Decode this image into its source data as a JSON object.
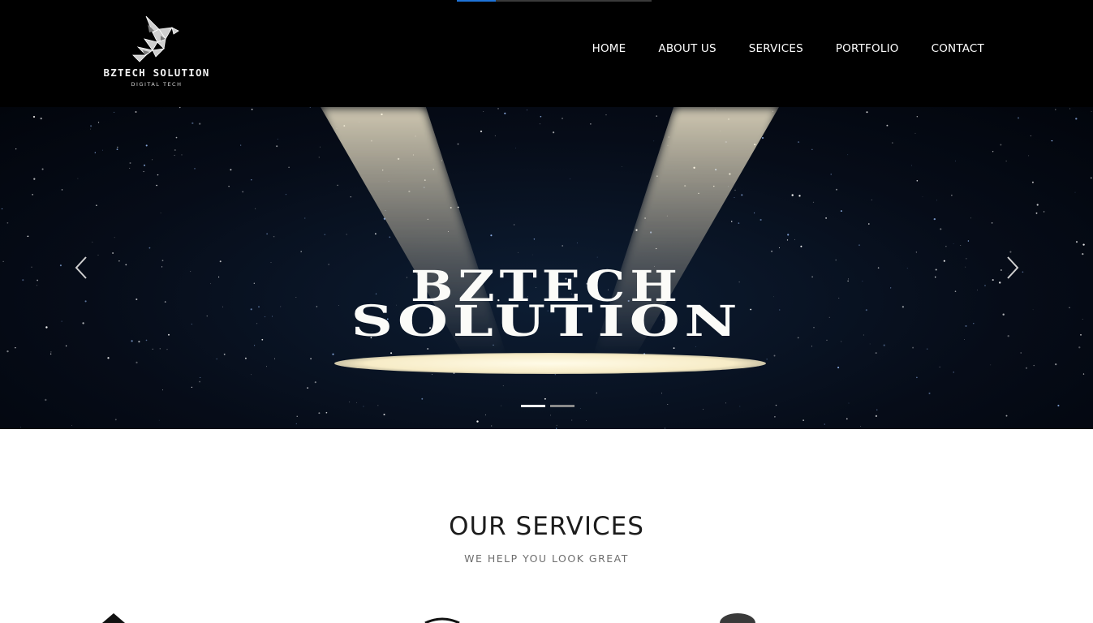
{
  "page_load_progress": 0.2,
  "header": {
    "logo": {
      "brand": "BZTECH SOLUTION",
      "tagline": "DIGITAL TECH",
      "icon": "hummingbird-icon"
    },
    "nav": [
      {
        "label": "HOME"
      },
      {
        "label": "ABOUT US"
      },
      {
        "label": "SERVICES"
      },
      {
        "label": "PORTFOLIO"
      },
      {
        "label": "CONTACT"
      }
    ]
  },
  "hero": {
    "title_line1": "BZTECH",
    "title_line2": "SOLUTION",
    "prev_icon": "chevron-left-icon",
    "next_icon": "chevron-right-icon",
    "slides_total": 2,
    "active_slide": 1
  },
  "services": {
    "title": "OUR SERVICES",
    "subtitle": "WE HELP YOU LOOK GREAT"
  },
  "colors": {
    "header_bg": "#000000",
    "progress_accent": "#1e73d8",
    "hero_bg": "#060c18",
    "spotlight": "#f7ecc7"
  }
}
